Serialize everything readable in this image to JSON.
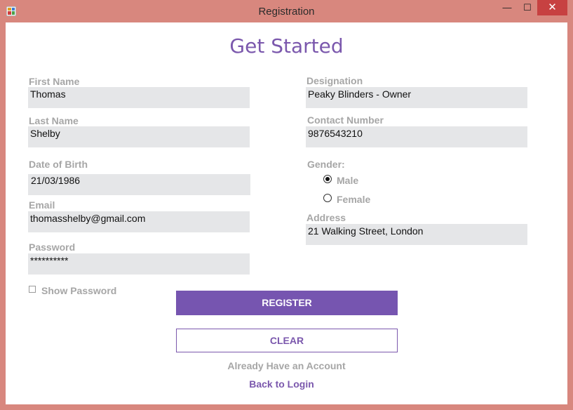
{
  "window": {
    "title": "Registration",
    "minimize": "—",
    "maximize": "☐",
    "close": "✕"
  },
  "heading": "Get Started",
  "form": {
    "first_name": {
      "label": "First Name",
      "value": "Thomas"
    },
    "last_name": {
      "label": "Last Name",
      "value": "Shelby"
    },
    "dob": {
      "label": "Date of Birth",
      "value": "21/03/1986"
    },
    "email": {
      "label": "Email",
      "value": "thomasshelby@gmail.com"
    },
    "password": {
      "label": "Password",
      "value": "**********"
    },
    "show_password": {
      "label": "Show Password",
      "checked": false
    },
    "designation": {
      "label": "Designation",
      "value": "Peaky Blinders - Owner"
    },
    "contact": {
      "label": "Contact Number",
      "value": "9876543210"
    },
    "gender": {
      "label": "Gender:",
      "options": [
        "Male",
        "Female"
      ],
      "selected": "Male"
    },
    "address": {
      "label": "Address",
      "value": "21 Walking Street, London"
    }
  },
  "buttons": {
    "register": "REGISTER",
    "clear": "CLEAR"
  },
  "footer": {
    "prompt": "Already Have an Account",
    "login_link": "Back to Login"
  },
  "colors": {
    "accent": "#7655b0",
    "titlebar": "#d8877e",
    "close": "#c74141",
    "field_bg": "#e5e6e8",
    "label": "#a6a6a6"
  },
  "icons": [
    "app-icon",
    "minimize-icon",
    "maximize-icon",
    "close-icon"
  ]
}
